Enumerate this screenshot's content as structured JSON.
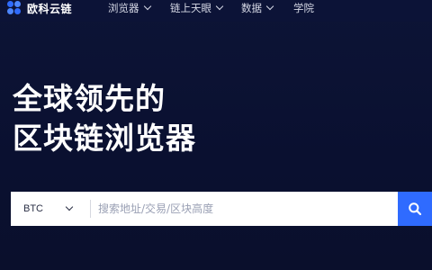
{
  "brand": {
    "name": "欧科云链",
    "accent_color": "#2f6bff"
  },
  "nav": {
    "items": [
      {
        "label": "浏览器",
        "has_dropdown": true
      },
      {
        "label": "链上天眼",
        "has_dropdown": true
      },
      {
        "label": "数据",
        "has_dropdown": true
      },
      {
        "label": "学院",
        "has_dropdown": false
      }
    ]
  },
  "hero": {
    "line1": "全球领先的",
    "line2": "区块链浏览器"
  },
  "search": {
    "selected_coin": "BTC",
    "placeholder": "搜索地址/交易/区块高度",
    "value": "",
    "button_icon": "search-icon"
  }
}
